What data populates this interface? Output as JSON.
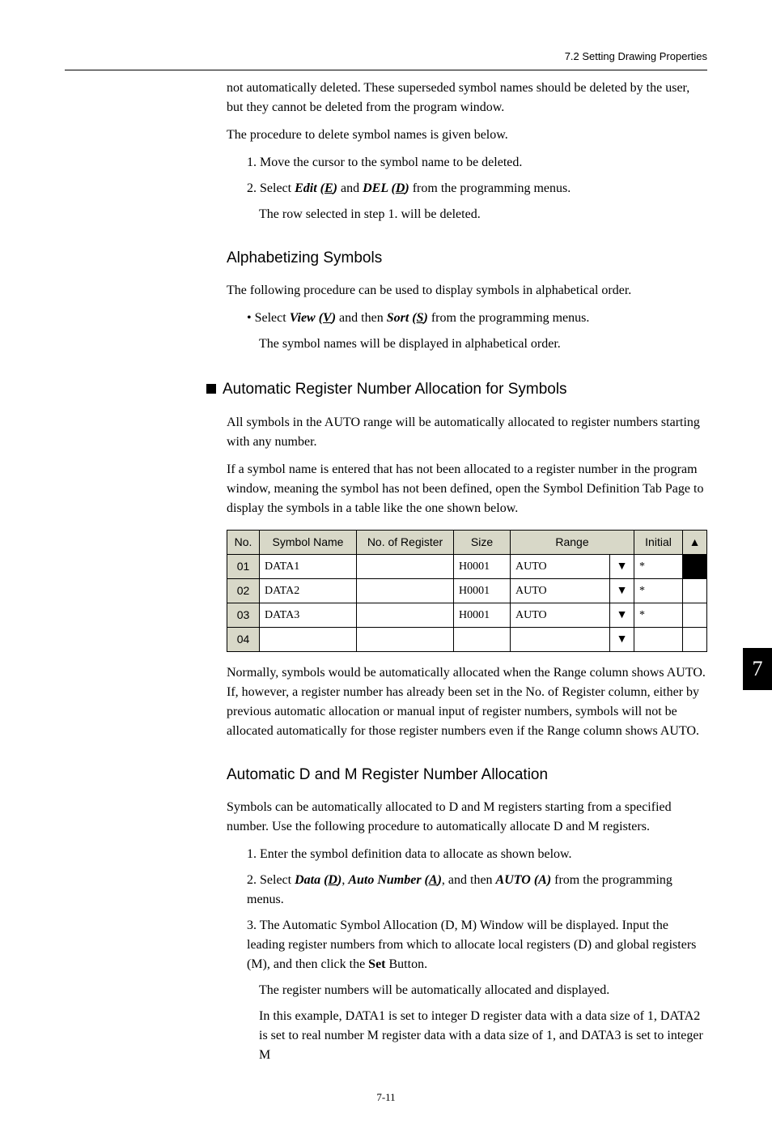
{
  "header": {
    "breadcrumb": "7.2  Setting Drawing Properties"
  },
  "intro": {
    "p1": "not automatically deleted. These superseded symbol names should be deleted by the user, but they cannot be deleted from the program window.",
    "p2": "The procedure to delete symbol names is given below.",
    "step1": "1.  Move the cursor to the symbol name to be deleted.",
    "step2_prefix": "2.  Select ",
    "step2_edit": "Edit (",
    "step2_edit_u": "E",
    "step2_edit_close": ")",
    "step2_and": " and ",
    "step2_del": "DEL (",
    "step2_del_u": "D",
    "step2_del_close": ")",
    "step2_suffix": " from the programming menus.",
    "step2_sub": "The row selected in step 1. will be deleted."
  },
  "alpha": {
    "title": "Alphabetizing Symbols",
    "p1": "The following procedure can be used to display symbols in alphabetical order.",
    "bullet_prefix": "•  Select ",
    "bullet_view": "View (",
    "bullet_view_u": "V",
    "bullet_view_close": ")",
    "bullet_mid": " and then ",
    "bullet_sort": "Sort (",
    "bullet_sort_u": "S",
    "bullet_sort_close": ")",
    "bullet_suffix": " from the programming menus.",
    "bullet_sub": "The symbol names will be displayed in alphabetical order."
  },
  "auto_reg": {
    "title": "Automatic Register Number Allocation for Symbols",
    "p1": "All symbols in the AUTO range will be automatically allocated to register numbers starting with any number.",
    "p2": "If a symbol name is entered that has not been allocated to a register number in the program window, meaning the symbol has not been defined, open the Symbol Definition Tab Page to display the symbols in a table like the one shown below.",
    "table": {
      "headers": {
        "no": "No.",
        "symbol_name": "Symbol Name",
        "no_of_register": "No. of Register",
        "size": "Size",
        "range": "Range",
        "initial": "Initial",
        "arrow_up": "▲"
      },
      "rows": [
        {
          "no": "01",
          "symbol_name": "DATA1",
          "no_of_register": "",
          "size": "H0001",
          "range": "AUTO",
          "range_arrow": "▼",
          "initial": "*",
          "last_black": true
        },
        {
          "no": "02",
          "symbol_name": "DATA2",
          "no_of_register": "",
          "size": "H0001",
          "range": "AUTO",
          "range_arrow": "▼",
          "initial": "*",
          "last_black": false
        },
        {
          "no": "03",
          "symbol_name": "DATA3",
          "no_of_register": "",
          "size": "H0001",
          "range": "AUTO",
          "range_arrow": "▼",
          "initial": "*",
          "last_black": false
        },
        {
          "no": "04",
          "symbol_name": "",
          "no_of_register": "",
          "size": "",
          "range": "",
          "range_arrow": "▼",
          "initial": "",
          "last_black": false
        }
      ]
    },
    "p3": "Normally, symbols would be automatically allocated when the Range column shows AUTO. If, however, a register number has already been set in the No. of Register column, either by previous automatic allocation or manual input of register numbers, symbols will not be allocated automatically for those register numbers even if the Range column shows AUTO."
  },
  "auto_dm": {
    "title": "Automatic D and M Register Number Allocation",
    "p1": "Symbols can be automatically allocated to D and M registers starting from a specified number. Use the following procedure to automatically allocate D and M registers.",
    "step1": "1.  Enter the symbol definition data to allocate as shown below.",
    "step2_prefix": "2.  Select ",
    "step2_data": "Data (",
    "step2_data_u": "D",
    "step2_data_close": ")",
    "step2_c1": ", ",
    "step2_auton": "Auto Number (",
    "step2_auton_u": "A",
    "step2_auton_close": ")",
    "step2_c2": ", and then ",
    "step2_auto": "AUTO (A)",
    "step2_suffix": " from the programming menus.",
    "step3_a": "3.  The Automatic Symbol Allocation (D, M) Window will be displayed. Input the leading register numbers from which to allocate local registers (D) and global registers (M), and then click the ",
    "step3_set": "Set",
    "step3_b": " Button.",
    "step3_sub1": "The register numbers will be automatically allocated and displayed.",
    "step3_sub2": "In this example, DATA1 is set to integer D register data with a data size of 1, DATA2 is set to real number M register data with a data size of 1, and DATA3 is set to integer M"
  },
  "side_tab": "7",
  "page_number": "7-11"
}
